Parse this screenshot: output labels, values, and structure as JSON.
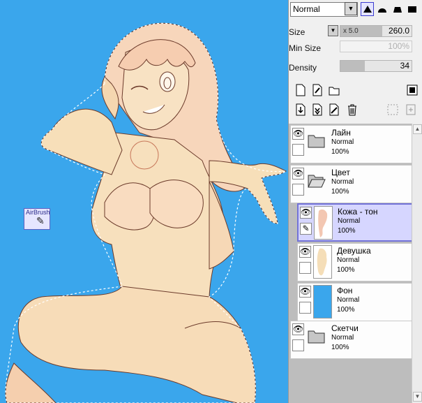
{
  "canvas": {
    "background_color": "#3aa6ec",
    "tool_tag": "AirBrush"
  },
  "brush": {
    "blend_mode": "Normal",
    "shapes": [
      "brush-shape-1-icon",
      "brush-shape-2-icon",
      "brush-shape-3-icon",
      "brush-shape-4-icon"
    ],
    "size": {
      "label": "Size",
      "multiplier": "x 5.0",
      "value": "260.0"
    },
    "min_size": {
      "label": "Min Size",
      "value": "100%"
    },
    "density": {
      "label": "Density",
      "value": "34"
    }
  },
  "toolbar": {
    "row1": [
      "new-layer-icon",
      "new-linework-layer-icon",
      "new-folder-icon"
    ],
    "row2": [
      "transfer-down-icon",
      "merge-down-icon",
      "clear-layer-icon",
      "delete-layer-icon"
    ]
  },
  "layers": [
    {
      "name": "Лайн",
      "mode": "Normal",
      "opacity": "100%",
      "type": "folder"
    },
    {
      "name": "Цвет",
      "mode": "Normal",
      "opacity": "100%",
      "type": "folder"
    },
    {
      "name": "Кожа - тон",
      "mode": "Normal",
      "opacity": "100%",
      "type": "layer",
      "selected": true
    },
    {
      "name": "Девушка",
      "mode": "Normal",
      "opacity": "100%",
      "type": "layer"
    },
    {
      "name": "Фон",
      "mode": "Normal",
      "opacity": "100%",
      "type": "layer",
      "thumb_color": "#3aa6ec"
    },
    {
      "name": "Скетчи",
      "mode": "Normal",
      "opacity": "100%",
      "type": "folder"
    }
  ],
  "colors": {
    "selection": "#d6d6ff",
    "selection_border": "#7272d8",
    "skin": "#f7dfb9",
    "skin_shade": "#f3b79a"
  }
}
